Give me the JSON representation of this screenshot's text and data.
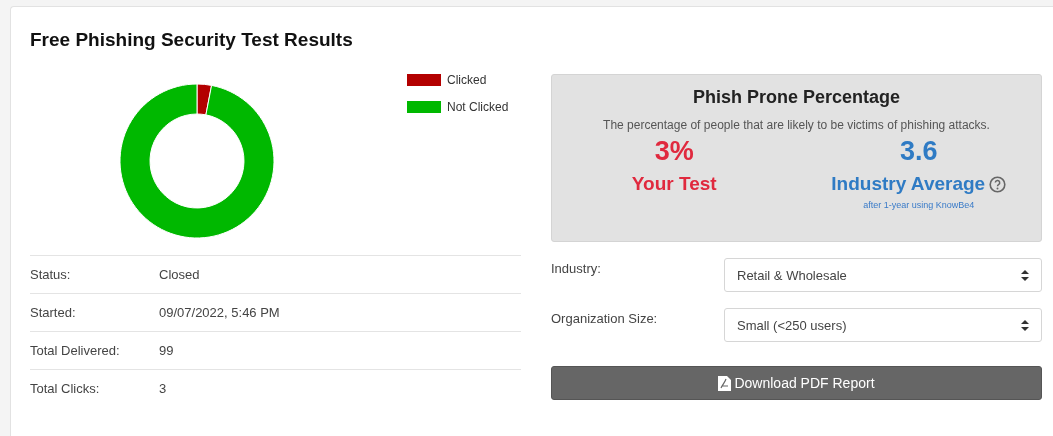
{
  "title": "Free Phishing Security Test Results",
  "chart": {
    "chart_data": {
      "type": "donut",
      "categories": [
        "Clicked",
        "Not Clicked"
      ],
      "values": [
        3,
        96
      ],
      "colors": [
        "#b30000",
        "#00b800"
      ]
    }
  },
  "details": [
    {
      "label": "Status:",
      "value": "Closed"
    },
    {
      "label": "Started:",
      "value": "09/07/2022, 5:46 PM"
    },
    {
      "label": "Total Delivered:",
      "value": "99"
    },
    {
      "label": "Total Clicks:",
      "value": "3"
    }
  ],
  "summary": {
    "title": "Phish Prone Percentage",
    "description": "The percentage of people that are likely to be victims of phishing attacks.",
    "stats": [
      {
        "kind": "test",
        "value": "3%",
        "label": "Your Test"
      },
      {
        "kind": "industry",
        "value": "3.6",
        "label": "Industry Average",
        "note": "after 1-year using KnowBe4"
      }
    ]
  },
  "fields": [
    {
      "label": "Industry:",
      "value": "Retail & Wholesale"
    },
    {
      "label": "Organization Size:",
      "value": "Small (<250 users)"
    }
  ],
  "download_button": "Download PDF Report"
}
